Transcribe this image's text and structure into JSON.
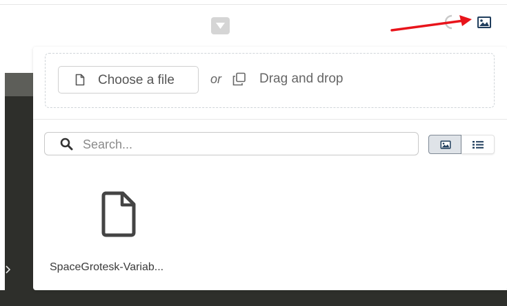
{
  "toolbar": {
    "caret_icon": "caret-down-icon",
    "image_icon": "image-icon"
  },
  "annotation": {
    "arrow_color": "#e8141b"
  },
  "upload": {
    "choose_label": "Choose a file",
    "or_text": "or",
    "drag_label": "Drag and drop"
  },
  "search": {
    "placeholder": "Search..."
  },
  "view_toggle": {
    "active": "grid",
    "grid_icon": "image-icon",
    "list_icon": "list-icon"
  },
  "files": [
    {
      "name": "SpaceGrotesk-Variab...",
      "icon": "file-icon"
    }
  ],
  "colors": {
    "dark": "#2e2f2b",
    "accent_border": "#7d8894"
  }
}
